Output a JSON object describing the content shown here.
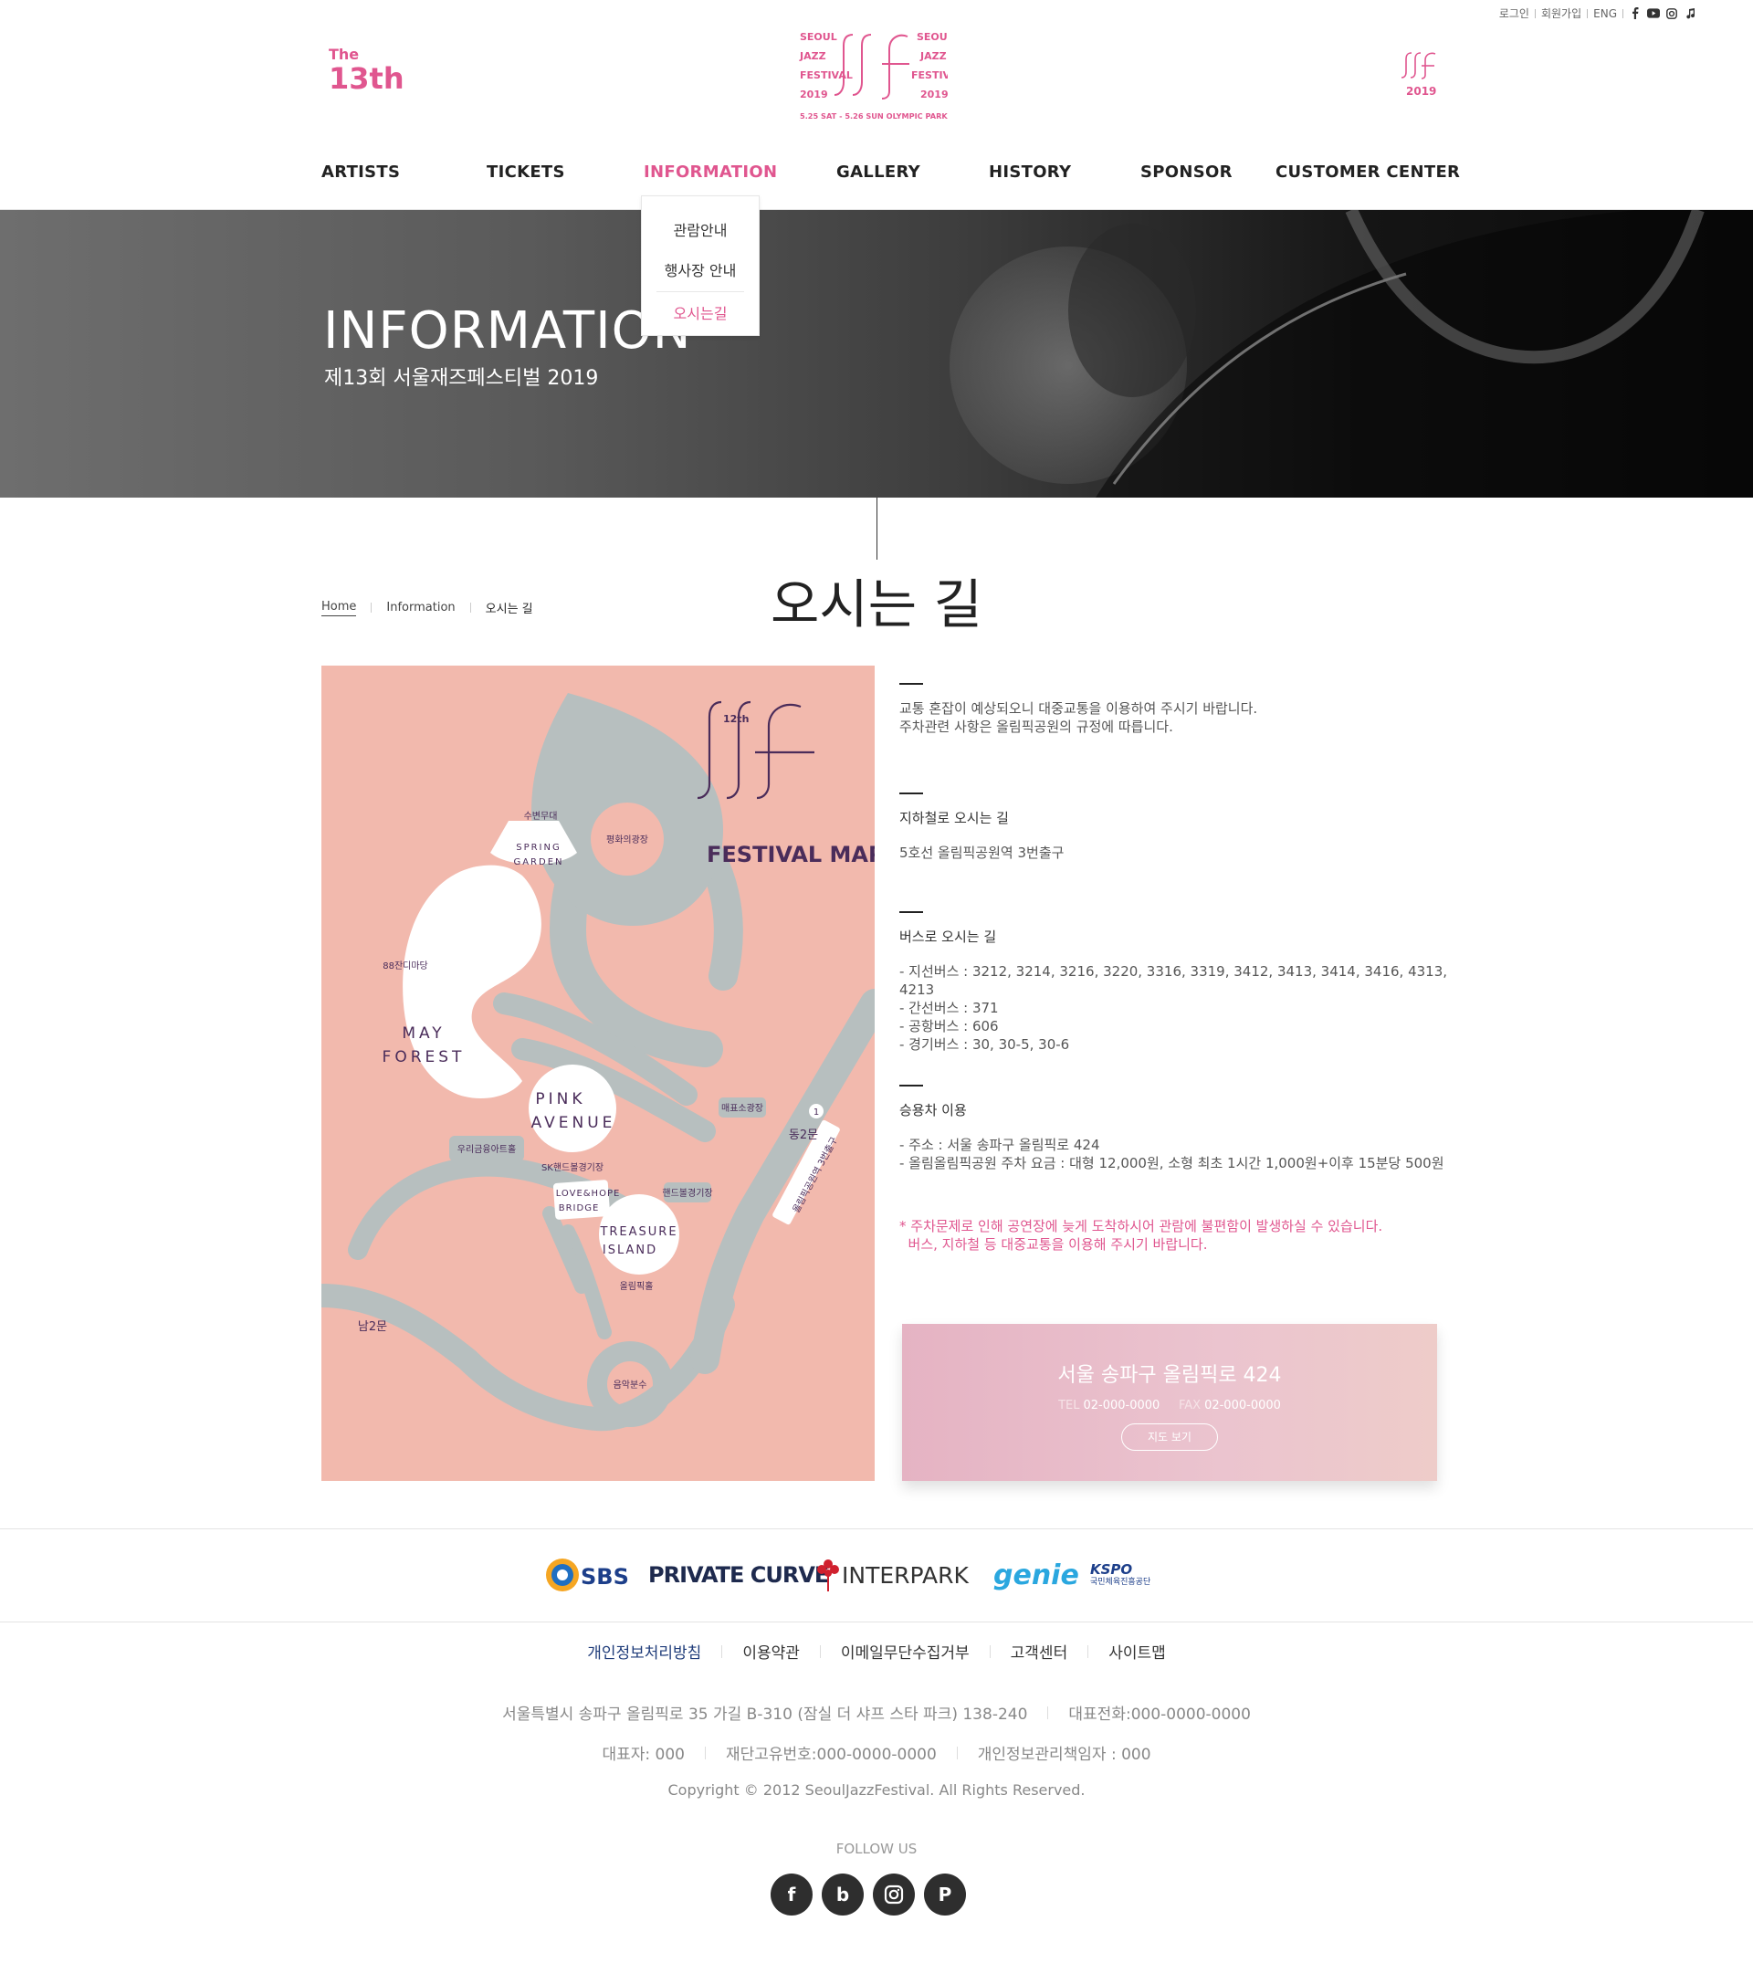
{
  "utility": {
    "login": "로그인",
    "signup": "회원가입",
    "lang": "ENG",
    "icons": [
      "facebook-icon",
      "youtube-icon",
      "instagram-icon",
      "music-icon"
    ]
  },
  "header": {
    "anniv_the": "The",
    "anniv_num": "13th",
    "logo_words": [
      "SEOUL",
      "JAZZ",
      "FESTIVAL",
      "2019"
    ],
    "logo_date": "5.25 SAT - 5.26 SUN OLYMPIC PARK",
    "logo_right_year": "2019",
    "brand_color": "#e0568f"
  },
  "nav": {
    "items": [
      "ARTISTS",
      "TICKETS",
      "INFORMATION",
      "GALLERY",
      "HISTORY",
      "SPONSOR",
      "CUSTOMER CENTER"
    ],
    "active": "INFORMATION",
    "dropdown": [
      "관람안내",
      "행사장 안내",
      "오시는길"
    ],
    "dropdown_selected": "오시는길"
  },
  "hero": {
    "title": "INFORMATION",
    "subtitle": "제13회 서울재즈페스티벌 2019"
  },
  "breadcrumb": [
    "Home",
    "Information",
    "오시는 길"
  ],
  "page_title": "오시는 길",
  "map": {
    "badge": "12th",
    "title": "FESTIVAL MAP",
    "labels": {
      "spring_stage": "수변무대",
      "spring_garden_1": "SPRING",
      "spring_garden_2": "GARDEN",
      "hall88": "88잔디마당",
      "may_1": "MAY",
      "may_2": "FOREST",
      "peace_plaza": "평화의광장",
      "pink_1": "PINK",
      "pink_2": "AVENUE",
      "sk_hall": "SK핸드볼경기장",
      "woori_hall": "우리금융아트홀",
      "love_1": "LOVE&HOPE",
      "love_2": "BRIDGE",
      "treasure_1": "TREASURE",
      "treasure_2": "ISLAND",
      "olympic_hall": "올림픽홀",
      "handball": "핸드볼경기장",
      "ticket_box": "매표소광장",
      "east_gate": "동2문",
      "south_gate": "남2문",
      "station": "올림픽공원역 3번출구",
      "fountain": "음악분수",
      "num1": "1"
    }
  },
  "info": {
    "notice": [
      "교통 혼잡이 예상되오니 대중교통을 이용하여 주시기 바랍니다.",
      "주차관련 사항은 올림픽공원의 규정에 따릅니다."
    ],
    "subway_title": "지하철로 오시는 길",
    "subway_detail": "5호선 올림픽공원역 3번출구",
    "bus_title": "버스로 오시는 길",
    "bus_lines": [
      "- 지선버스 : 3212, 3214, 3216, 3220, 3316, 3319, 3412, 3413, 3414, 3416, 4313, 4213",
      "- 간선버스 : 371",
      "- 공항버스 : 606",
      "- 경기버스 : 30, 30-5, 30-6"
    ],
    "car_title": "승용차 이용",
    "car_lines": [
      "- 주소 : 서울 송파구 올림픽로 424",
      "- 올림올림픽공원 주차 요금 : 대형 12,000원, 소형 최초 1시간 1,000원+이후 15분당 500원"
    ],
    "warning": [
      "* 주차문제로 인해 공연장에 늦게 도착하시어 관람에 불편함이 발생하실 수 있습니다.",
      "  버스, 지하철 등 대중교통을 이용해 주시기 바랍니다."
    ]
  },
  "address_box": {
    "address": "서울 송파구 올림픽로 424",
    "tel_label": "TEL",
    "tel": "02-000-0000",
    "fax_label": "FAX",
    "fax": "02-000-0000",
    "button": "지도 보기"
  },
  "sponsors": {
    "sbs": "SBS",
    "private_curve": "PRIVATE CURVE",
    "interpark": "INTERPARK",
    "genie": "genie",
    "kspo": "KSPO",
    "kspo_sub": "국민체육진흥공단"
  },
  "footer": {
    "links": [
      "개인정보처리방침",
      "이용약관",
      "이메일무단수집거부",
      "고객센터",
      "사이트맵"
    ],
    "address": "서울특별시 송파구 올림픽로 35 가길 B-310 (잠실 더 샤프 스타 파크) 138-240",
    "phone": "대표전화:000-0000-0000",
    "ceo": "대표자: 000",
    "corp_no": "재단고유번호:000-0000-0000",
    "privacy_officer": "개인정보관리책임자 : 000",
    "copyright": "Copyright © 2012 SeoulJazzFestival. All Rights Reserved.",
    "follow": "FOLLOW US",
    "social": [
      "f",
      "b",
      "instagram-icon",
      "P"
    ]
  }
}
